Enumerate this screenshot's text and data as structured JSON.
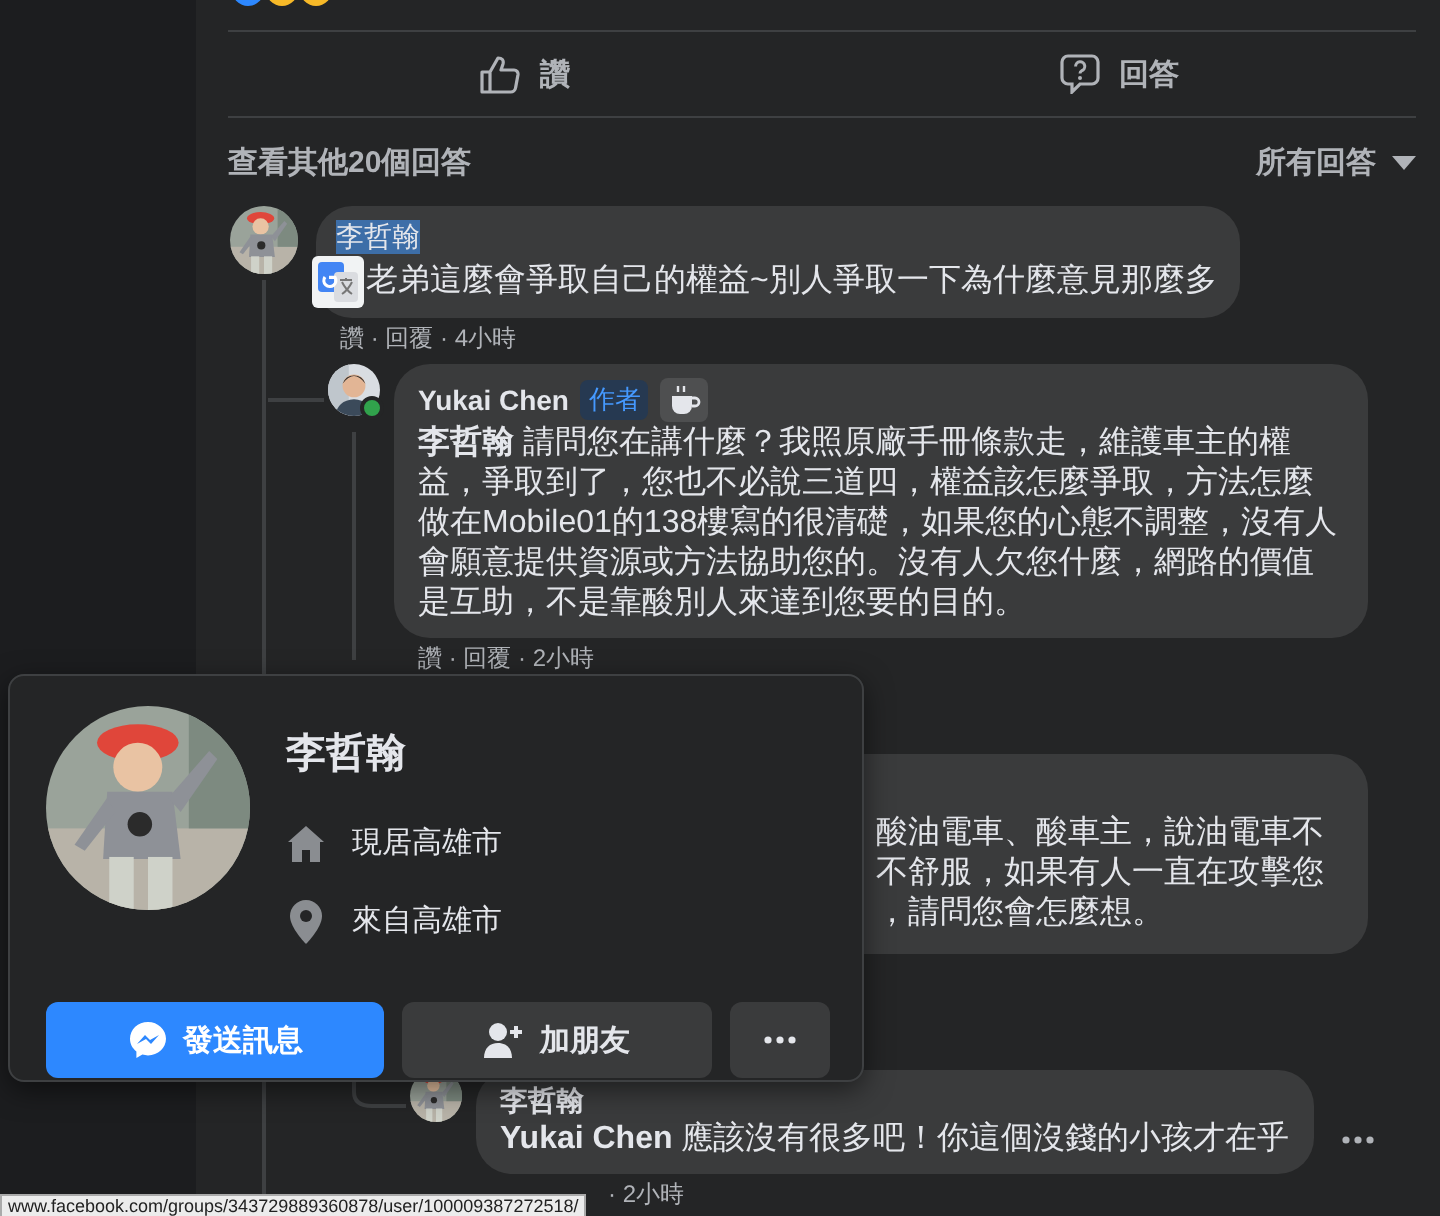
{
  "actions": [
    {
      "kind": "like",
      "label": "讚"
    },
    {
      "kind": "reply",
      "label": "回答"
    }
  ],
  "more_replies": {
    "label": "查看其他20個回答"
  },
  "sort": {
    "label": "所有回答"
  },
  "comments": [
    {
      "kind": "full",
      "author": "李哲翰",
      "name_highlighted": true,
      "translate_badge": true,
      "text": "老弟這麼會爭取自己的權益~別人爭取一下為什麼意見那麼多",
      "meta": "讚 · 回覆 · 4小時"
    },
    {
      "kind": "full",
      "author": "Yukai Chen",
      "online": true,
      "badge": "作者",
      "text": "**李哲翰** 請問您在講什麼？我照原廠手冊條款走，維護車主的權益，爭取到了，您也不必說三道四，權益該怎麼爭取，方法怎麼做在Mobile01的138樓寫的很清礎，如果您的心態不調整，沒有人會願意提供資源或方法協助您的。沒有人欠您什麼，網路的價值是互助，不是靠酸別人來達到您要的目的。",
      "meta": "讚 · 回覆 · 2小時"
    },
    {
      "kind": "partial",
      "lines": [
        "酸油電車、酸車主，說油電車不",
        "不舒服，如果有人一直在攻擊您",
        "，請問您會怎麼想。"
      ]
    },
    {
      "kind": "full",
      "author": "李哲翰",
      "text": "**Yukai Chen** 應該沒有很多吧！你這個沒錢的小孩才在乎",
      "meta": "· 2小時"
    }
  ],
  "hovercard": {
    "name": "李哲翰",
    "details": [
      {
        "kind": "home",
        "text": "現居高雄市"
      },
      {
        "kind": "place",
        "text": "來自高雄市"
      }
    ],
    "buttons": [
      {
        "kind": "message",
        "label": "發送訊息"
      },
      {
        "kind": "add_friend",
        "label": "加朋友"
      },
      {
        "kind": "more"
      }
    ]
  },
  "status_bar": {
    "url": "www.facebook.com/groups/343729889360878/user/100009387272518/"
  }
}
